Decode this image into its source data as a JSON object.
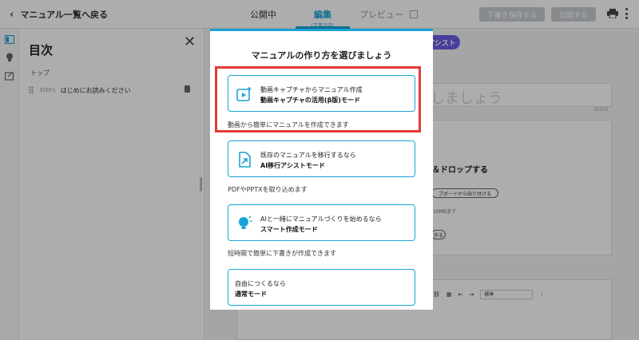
{
  "header": {
    "back_label": "マニュアル一覧へ戻る",
    "tab_public": "公開中",
    "tab_edit": "編集",
    "tab_edit_sub": "(下書き中)",
    "tab_preview": "プレビュー",
    "draft_button": "下書き保存する",
    "publish_button": "公開する"
  },
  "sidebar": {
    "title": "目次",
    "section_top": "トップ",
    "steps": [
      {
        "number": "STEP.1",
        "label": "はじめにお読みください"
      }
    ]
  },
  "background": {
    "assist_pill": "アシスト",
    "title_placeholder": "しましょう",
    "title_counter": "0/150",
    "drop_title": "＆ドロップする",
    "paste_button": "プボードから貼り付ける",
    "size_note": ":10MBまで",
    "make_button": "作る",
    "format_select": "標準"
  },
  "modal": {
    "title": "マニュアルの作り方を選びましょう",
    "options": [
      {
        "line1": "動画キャプチャからマニュアル作成",
        "line2": "動画キャプチャの活用(β版)モード",
        "desc": "動画から簡単にマニュアルを作成できます",
        "icon": "video-capture-icon"
      },
      {
        "line1": "既存のマニュアルを移行するなら",
        "line2": "AI移行アシストモード",
        "desc": "PDFやPPTXを取り込めます",
        "icon": "file-import-icon"
      },
      {
        "line1": "AIと一緒にマニュアルづくりを始めるなら",
        "line2": "スマート作成モード",
        "desc": "短時間で簡単に下書きが作成できます",
        "icon": "lightbulb-icon"
      },
      {
        "line1": "自由につくるなら",
        "line2": "通常モード"
      }
    ]
  },
  "colors": {
    "accent": "#1aa3d6",
    "highlight": "#e53935",
    "purple": "#6c5ce7"
  }
}
